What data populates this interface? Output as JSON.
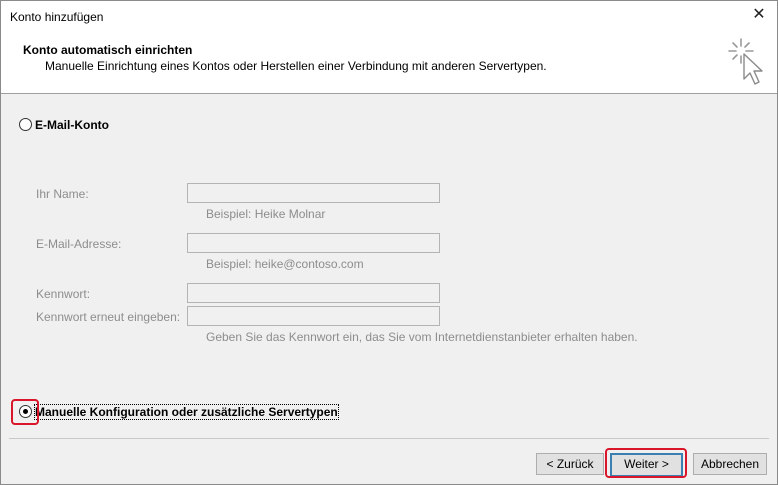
{
  "window": {
    "title": "Konto hinzufügen",
    "close_glyph": "✕"
  },
  "header": {
    "title": "Konto automatisch einrichten",
    "subtitle": "Manuelle Einrichtung eines Kontos oder Herstellen einer Verbindung mit anderen Servertypen."
  },
  "options": {
    "email": {
      "label": "E-Mail-Konto",
      "selected": false
    },
    "manual": {
      "label": "Manuelle Konfiguration oder zusätzliche Servertypen",
      "selected": true
    }
  },
  "form": {
    "name_label": "Ihr Name:",
    "name_value": "",
    "name_hint": "Beispiel: Heike Molnar",
    "email_label": "E-Mail-Adresse:",
    "email_value": "",
    "email_hint": "Beispiel: heike@contoso.com",
    "password_label": "Kennwort:",
    "password_value": "",
    "password_repeat_label": "Kennwort erneut eingeben:",
    "password_repeat_value": "",
    "password_hint": "Geben Sie das Kennwort ein, das Sie vom Internetdienstanbieter erhalten haben."
  },
  "buttons": {
    "back": "< Zurück",
    "next": "Weiter >",
    "cancel": "Abbrechen"
  },
  "icons": {
    "header_icon": "magic-wand-cursor-icon"
  },
  "colors": {
    "highlight": "#d9162a",
    "default_button_border": "#3c7fb1",
    "disabled_text": "#8d8d8d"
  }
}
